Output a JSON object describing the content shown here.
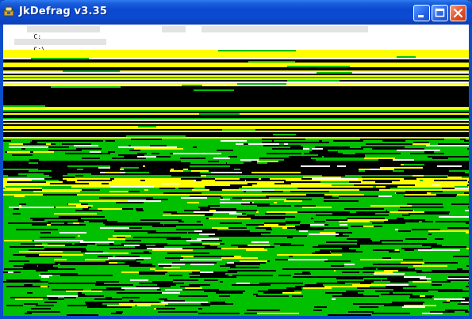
{
  "window": {
    "title": "JkDefrag v3.35",
    "icon": "jkdefrag-app-icon",
    "buttons": [
      "minimize-button",
      "maximize-button",
      "close-button"
    ]
  },
  "status": {
    "line1_prefix": "C:",
    "line2_prefix": "C:\\"
  },
  "colors": {
    "title_bar": "#0b4ad1",
    "used_unfragmented": "#00c000",
    "fragmented": "#ffff00",
    "free_space": "#000000",
    "unmovable": "#ffffff",
    "mft": "#ffd000"
  }
}
